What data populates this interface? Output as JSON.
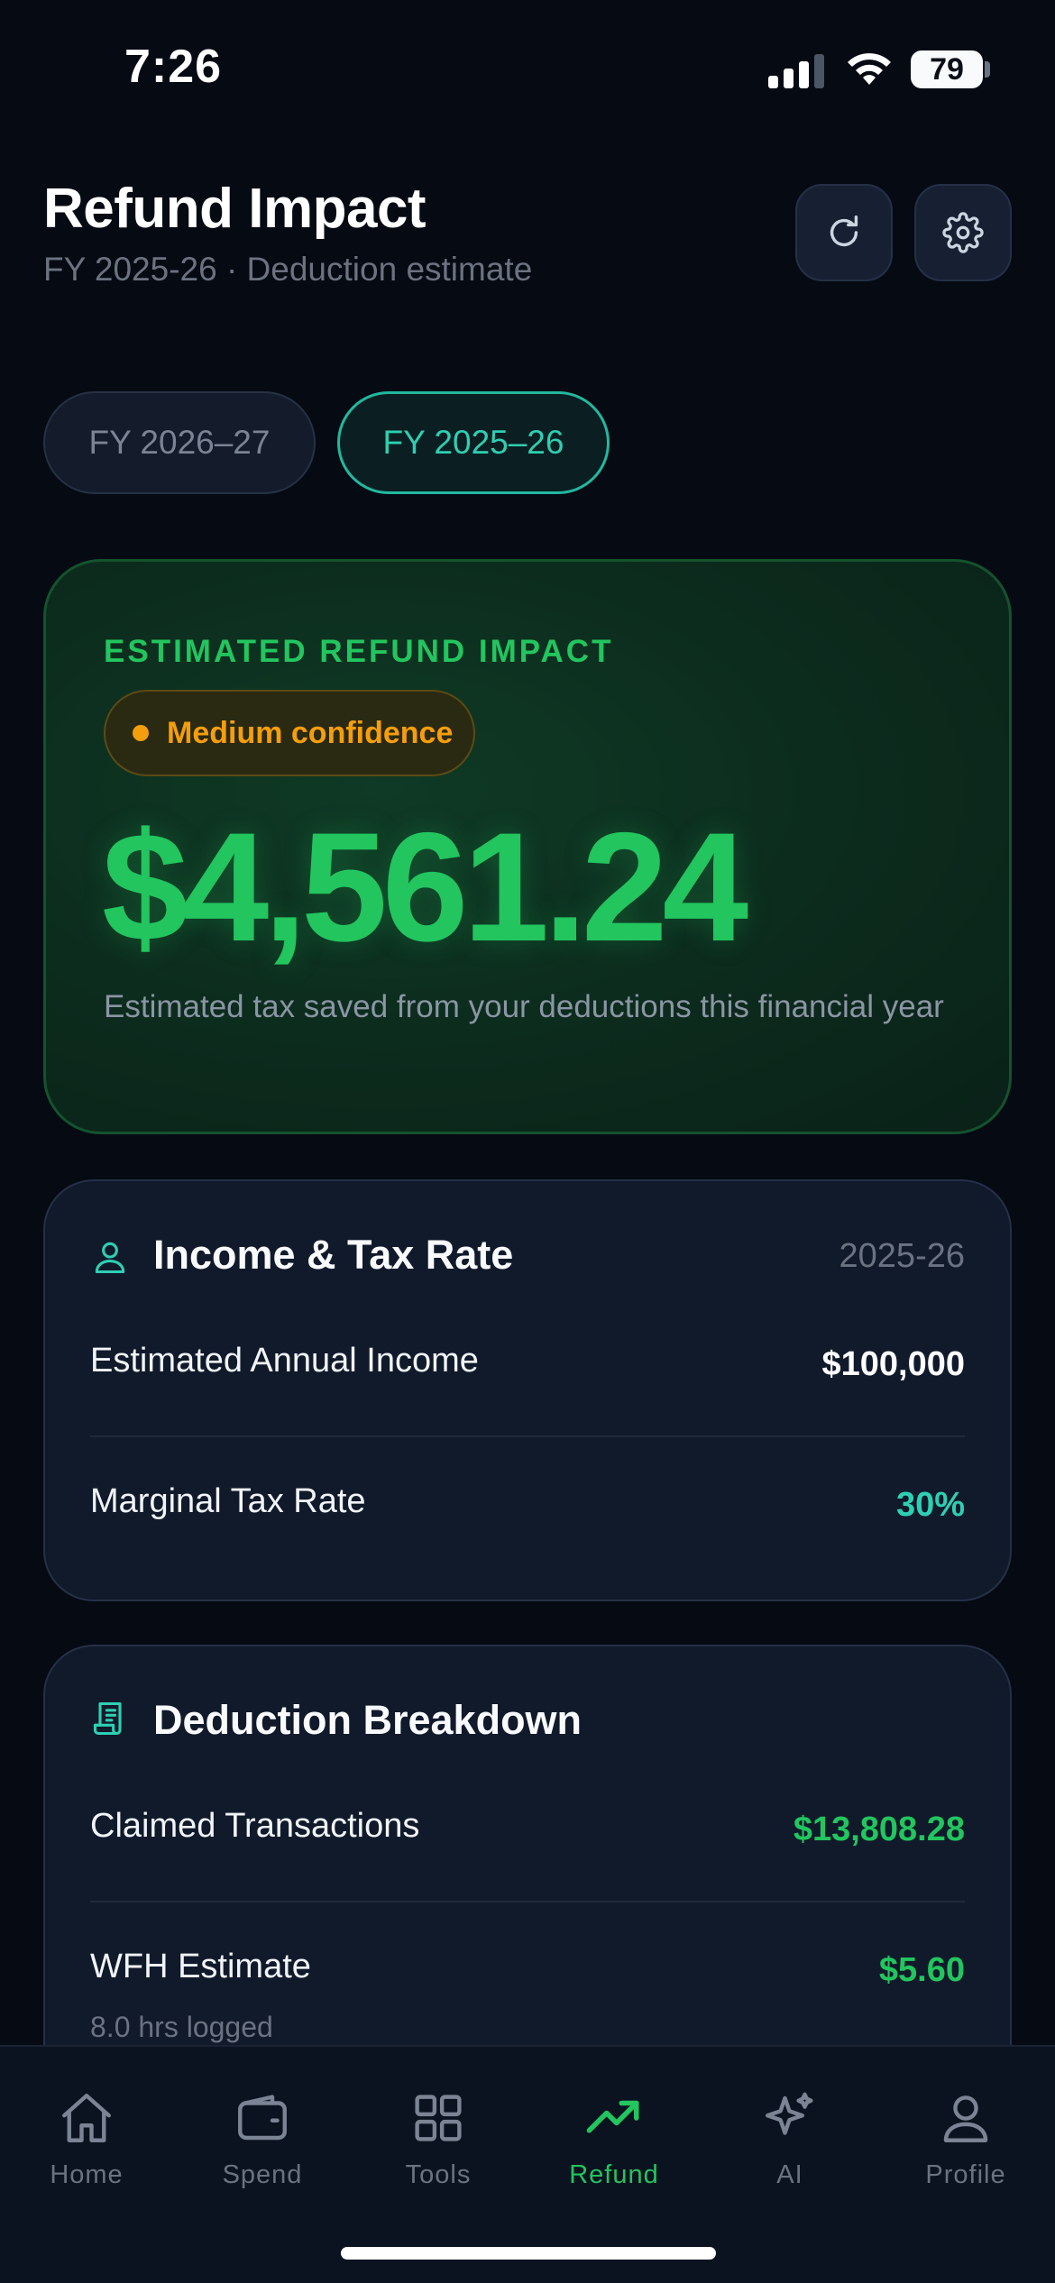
{
  "status_bar": {
    "time": "7:26",
    "battery": "79"
  },
  "header": {
    "title": "Refund Impact",
    "subtitle": "FY 2025-26 · Deduction estimate",
    "refresh_icon": "refresh-icon",
    "settings_icon": "gear-icon"
  },
  "year_tabs": [
    {
      "label": "FY 2026–27",
      "selected": false
    },
    {
      "label": "FY 2025–26",
      "selected": true
    }
  ],
  "refund_card": {
    "kicker": "ESTIMATED REFUND IMPACT",
    "confidence": "Medium confidence",
    "amount": "$4,561.24",
    "description": "Estimated tax saved from your deductions this financial year",
    "accent_color": "#22c55e",
    "confidence_color": "#f59e0b"
  },
  "income_card": {
    "icon": "user-icon",
    "title": "Income & Tax Rate",
    "year": "2025-26",
    "rows": [
      {
        "label": "Estimated Annual Income",
        "value": "$100,000"
      },
      {
        "label": "Marginal Tax Rate",
        "value": "30%"
      }
    ]
  },
  "deduction_card": {
    "icon": "receipt-icon",
    "title": "Deduction Breakdown",
    "rows": [
      {
        "label": "Claimed Transactions",
        "value": "$13,808.28"
      },
      {
        "label": "WFH Estimate",
        "value": "$5.60",
        "sub": "8.0 hrs logged"
      }
    ]
  },
  "bottom_nav": {
    "items": [
      {
        "label": "Home",
        "icon": "home-icon"
      },
      {
        "label": "Spend",
        "icon": "wallet-icon"
      },
      {
        "label": "Tools",
        "icon": "grid-icon"
      },
      {
        "label": "Refund",
        "icon": "trending-up-icon",
        "active": true
      },
      {
        "label": "AI",
        "icon": "sparkles-icon"
      },
      {
        "label": "Profile",
        "icon": "person-icon"
      }
    ]
  }
}
